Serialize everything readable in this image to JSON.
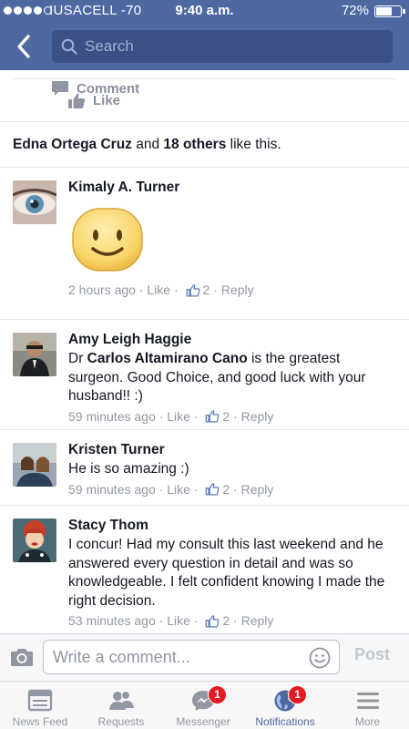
{
  "status_bar": {
    "carrier": "IUSACELL -70",
    "time": "9:40 a.m.",
    "battery_percent": "72%",
    "battery_level": 0.72
  },
  "search": {
    "placeholder": "Search"
  },
  "actions": {
    "like": "Like",
    "comment": "Comment"
  },
  "likers": {
    "first_name": "Edna Ortega Cruz",
    "connector": " and ",
    "others": "18 others",
    "suffix": " like this."
  },
  "comments": [
    {
      "name": "Kimaly A. Turner",
      "text": "",
      "sticker": "smiley-sticker",
      "time": "2 hours ago",
      "like": "Like",
      "likes": "2",
      "reply": "Reply"
    },
    {
      "name": "Amy Leigh Haggie",
      "text_prefix": "Dr ",
      "text_bold": "Carlos Altamirano Cano",
      "text_suffix": " is the greatest surgeon.  Good Choice, and good luck with your husband!! :)",
      "time": "59 minutes ago",
      "like": "Like",
      "likes": "2",
      "reply": "Reply"
    },
    {
      "name": "Kristen Turner",
      "text": "He is so amazing :)",
      "time": "59 minutes ago",
      "like": "Like",
      "likes": "2",
      "reply": "Reply"
    },
    {
      "name": "Stacy Thom",
      "text": "I concur!  Had my consult this last weekend and he answered every question in detail and was so knowledgeable.  I felt confident knowing I made the right decision.",
      "time": "53 minutes ago",
      "like": "Like",
      "likes": "2",
      "reply": "Reply"
    }
  ],
  "composer": {
    "placeholder": "Write a comment...",
    "post": "Post"
  },
  "tabs": [
    {
      "label": "News Feed",
      "icon": "news-feed-icon"
    },
    {
      "label": "Requests",
      "icon": "friend-requests-icon"
    },
    {
      "label": "Messenger",
      "icon": "messenger-icon",
      "badge": "1"
    },
    {
      "label": "Notifications",
      "icon": "globe-icon",
      "badge": "1",
      "active": true
    },
    {
      "label": "More",
      "icon": "menu-icon"
    }
  ],
  "colors": {
    "brand": "#4e69a2",
    "search_bg": "#3b5084",
    "badge": "#e41b23",
    "meta": "#9197a3"
  }
}
